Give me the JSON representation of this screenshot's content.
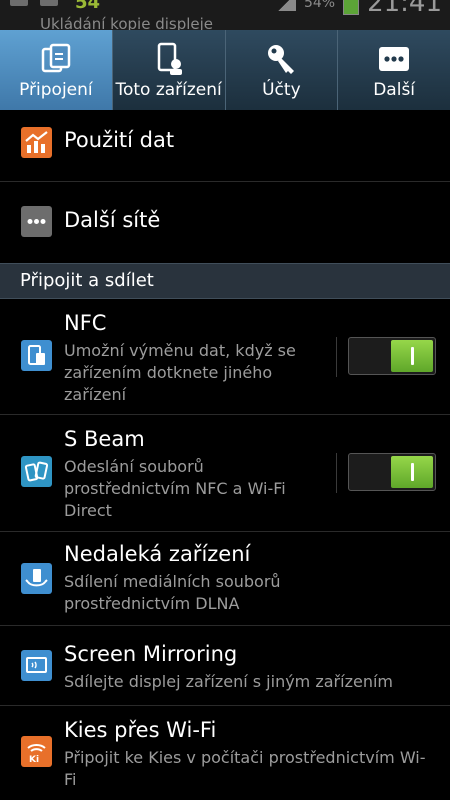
{
  "status_bar": {
    "notification_text": "Ukládání kopie displeje",
    "left_number": "54",
    "battery_percent": "54%",
    "time": "21:41"
  },
  "tabs": [
    {
      "label": "Připojení",
      "icon": "connections-icon",
      "active": true
    },
    {
      "label": "Toto zařízení",
      "icon": "device-icon",
      "active": false
    },
    {
      "label": "Účty",
      "icon": "key-icon",
      "active": false
    },
    {
      "label": "Další",
      "icon": "more-dots-icon",
      "active": false
    }
  ],
  "top_items": [
    {
      "title": "Použití dat",
      "icon": "data-usage-icon"
    },
    {
      "title": "Další sítě",
      "icon": "more-networks-icon"
    }
  ],
  "section": {
    "title": "Připojit a sdílet"
  },
  "items": [
    {
      "title": "NFC",
      "subtitle": "Umožní výměnu dat, když se zařízením dotknete jiného zařízení",
      "toggle": true,
      "icon": "nfc-icon"
    },
    {
      "title": "S Beam",
      "subtitle": "Odeslání souborů prostřednictvím NFC a Wi-Fi Direct",
      "toggle": true,
      "icon": "s-beam-icon"
    },
    {
      "title": "Nedaleká zařízení",
      "subtitle": "Sdílení mediálních souborů prostřednictvím DLNA",
      "icon": "nearby-devices-icon"
    },
    {
      "title": "Screen Mirroring",
      "subtitle": "Sdílejte displej zařízení s jiným zařízením",
      "icon": "screen-mirroring-icon"
    },
    {
      "title": "Kies přes Wi-Fi",
      "subtitle": "Připojit ke Kies v počítači prostřednictvím Wi-Fi",
      "icon": "kies-wifi-icon"
    }
  ],
  "colors": {
    "active_tab": "#4f8dc0",
    "toggle_on": "#7dc43a",
    "data_usage_icon": "#e8702a",
    "kies_icon": "#e8702a",
    "blue_icon": "#3f8fd0"
  }
}
